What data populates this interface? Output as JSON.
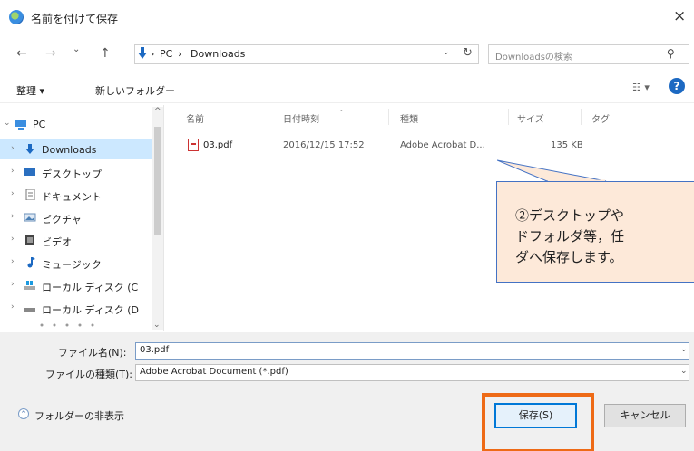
{
  "window": {
    "title": "名前を付けて保存",
    "close_glyph": "×"
  },
  "address": {
    "back_glyph": "←",
    "forward_glyph": "→",
    "recent_glyph": "⌄",
    "up_glyph": "↑",
    "separator": "›",
    "crumbs": [
      "PC",
      "Downloads"
    ],
    "dropdown_glyph": "⌄",
    "refresh_glyph": "↻",
    "search_placeholder": "Downloadsの検索",
    "search_glyph": "⚲"
  },
  "toolbar": {
    "organize_label": "整理 ▾",
    "new_folder_label": "新しいフォルダー",
    "view_glyph": "☷ ▾",
    "help_glyph": "?"
  },
  "sidebar": {
    "items": [
      {
        "chev": "⌄",
        "label": "PC",
        "icon": "pc-icon"
      },
      {
        "chev": "›",
        "label": "Downloads",
        "icon": "download-arrow-icon"
      },
      {
        "chev": "›",
        "label": "デスクトップ",
        "icon": "desktop-icon"
      },
      {
        "chev": "›",
        "label": "ドキュメント",
        "icon": "documents-icon"
      },
      {
        "chev": "›",
        "label": "ピクチャ",
        "icon": "pictures-icon"
      },
      {
        "chev": "›",
        "label": "ビデオ",
        "icon": "videos-icon"
      },
      {
        "chev": "›",
        "label": "ミュージック",
        "icon": "music-icon"
      },
      {
        "chev": "›",
        "label": "ローカル ディスク (C",
        "icon": "windows-drive-icon"
      },
      {
        "chev": "›",
        "label": "ローカル ディスク (D",
        "icon": "drive-icon"
      }
    ],
    "scroll_up_glyph": "^",
    "scroll_down_glyph": "⌄"
  },
  "columns": [
    "名前",
    "日付時刻",
    "種類",
    "サイズ",
    "タグ"
  ],
  "files": [
    {
      "name": "03.pdf",
      "date": "2016/12/15 17:52",
      "type": "Adobe Acrobat D...",
      "size": "135 KB",
      "tags": "",
      "icon": "pdf-file-icon"
    }
  ],
  "callout": {
    "lines": [
      "②デスクトップや",
      "ドフォルダ等，任",
      "ダへ保存します。"
    ],
    "fill": "#fde9d9",
    "border": "#4472c4"
  },
  "form": {
    "filename_label": "ファイル名(N):",
    "filename_value": "03.pdf",
    "filetype_label": "ファイルの種類(T):",
    "filetype_value": "Adobe Acrobat Document (*.pdf)",
    "dropdown_glyph": "⌄"
  },
  "footer": {
    "hide_folders_label": "フォルダーの非表示",
    "hide_glyph": "^",
    "save_label": "保存(S)",
    "cancel_label": "キャンセル"
  },
  "colors": {
    "selection": "#cce8ff",
    "highlight": "#ee6a16",
    "accent": "#0078d7"
  }
}
